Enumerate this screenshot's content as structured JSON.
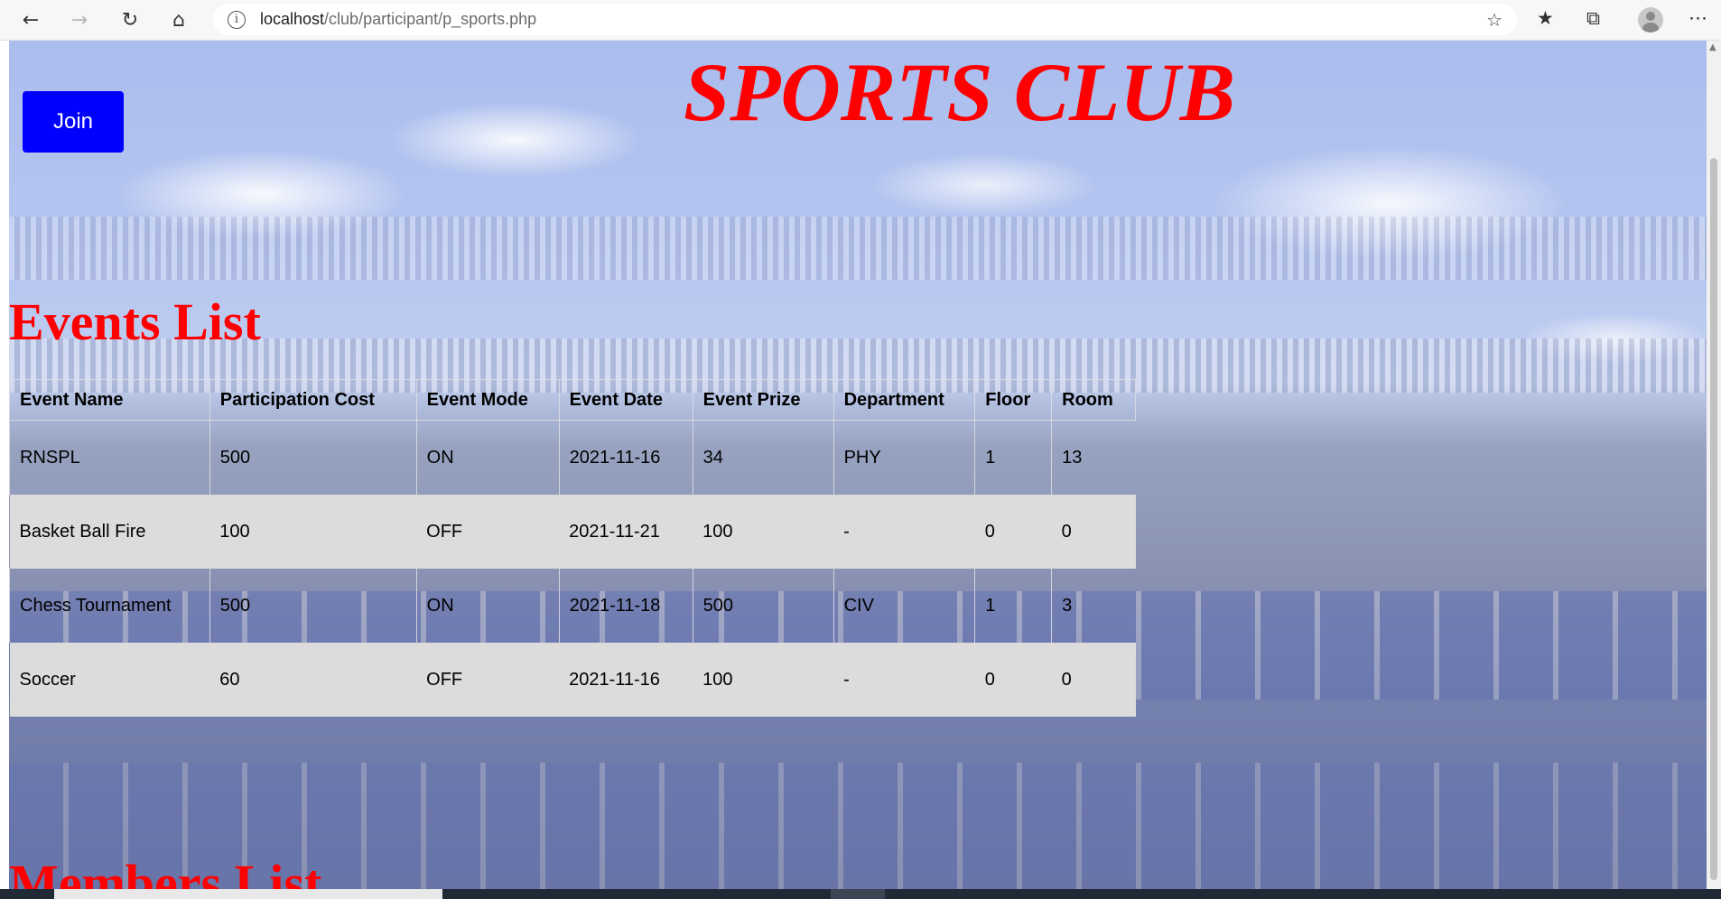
{
  "browser": {
    "url_host": "localhost",
    "url_path": "/club/participant/p_sports.php",
    "icons": [
      "back-icon",
      "forward-icon",
      "reload-icon",
      "home-icon",
      "info-icon",
      "add-favorite-icon",
      "favorites-icon",
      "collections-icon",
      "profile-icon",
      "more-icon"
    ]
  },
  "page": {
    "title": "SPORTS CLUB",
    "join_label": "Join",
    "events_heading": "Events List",
    "members_heading": "Members List",
    "accent_color": "#ff0000",
    "button_color": "#0000ff"
  },
  "events": {
    "columns": [
      "Event Name",
      "Participation Cost",
      "Event Mode",
      "Event Date",
      "Event Prize",
      "Department",
      "Floor",
      "Room"
    ],
    "rows": [
      [
        "RNSPL",
        "500",
        "ON",
        "2021-11-16",
        "34",
        "PHY",
        "1",
        "13"
      ],
      [
        "Basket Ball Fire",
        "100",
        "OFF",
        "2021-11-21",
        "100",
        "-",
        "0",
        "0"
      ],
      [
        "Chess Tournament",
        "500",
        "ON",
        "2021-11-18",
        "500",
        "CIV",
        "1",
        "3"
      ],
      [
        "Soccer",
        "60",
        "OFF",
        "2021-11-16",
        "100",
        "-",
        "0",
        "0"
      ]
    ]
  }
}
